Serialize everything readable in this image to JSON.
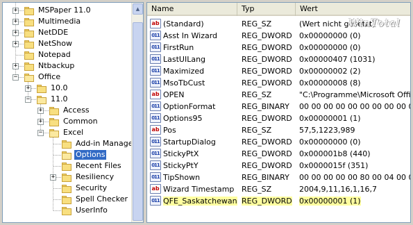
{
  "tree": {
    "items": [
      {
        "label": "MSPaper 11.0",
        "level": 1,
        "expander": "+",
        "selected": false
      },
      {
        "label": "Multimedia",
        "level": 1,
        "expander": "+",
        "selected": false
      },
      {
        "label": "NetDDE",
        "level": 1,
        "expander": "+",
        "selected": false
      },
      {
        "label": "NetShow",
        "level": 1,
        "expander": "+",
        "selected": false
      },
      {
        "label": "Notepad",
        "level": 1,
        "expander": "",
        "selected": false
      },
      {
        "label": "Ntbackup",
        "level": 1,
        "expander": "+",
        "selected": false
      },
      {
        "label": "Office",
        "level": 1,
        "expander": "-",
        "selected": false
      },
      {
        "label": "10.0",
        "level": 2,
        "expander": "+",
        "selected": false
      },
      {
        "label": "11.0",
        "level": 2,
        "expander": "-",
        "selected": false
      },
      {
        "label": "Access",
        "level": 3,
        "expander": "+",
        "selected": false
      },
      {
        "label": "Common",
        "level": 3,
        "expander": "+",
        "selected": false
      },
      {
        "label": "Excel",
        "level": 3,
        "expander": "-",
        "selected": false
      },
      {
        "label": "Add-in Manage",
        "level": 4,
        "expander": "",
        "selected": false
      },
      {
        "label": "Options",
        "level": 4,
        "expander": "",
        "selected": true
      },
      {
        "label": "Recent Files",
        "level": 4,
        "expander": "",
        "selected": false
      },
      {
        "label": "Resiliency",
        "level": 4,
        "expander": "+",
        "selected": false
      },
      {
        "label": "Security",
        "level": 4,
        "expander": "",
        "selected": false
      },
      {
        "label": "Spell Checker",
        "level": 4,
        "expander": "",
        "selected": false
      },
      {
        "label": "UserInfo",
        "level": 4,
        "expander": "",
        "selected": false
      }
    ]
  },
  "list": {
    "columns": {
      "name": "Name",
      "type": "Typ",
      "value": "Wert"
    },
    "rows": [
      {
        "icon": "ab",
        "name": "(Standard)",
        "type": "REG_SZ",
        "value": "(Wert nicht gesetzt)",
        "highlight": false
      },
      {
        "icon": "bin",
        "name": "Asst In Wizard",
        "type": "REG_DWORD",
        "value": "0x00000000 (0)",
        "highlight": false
      },
      {
        "icon": "bin",
        "name": "FirstRun",
        "type": "REG_DWORD",
        "value": "0x00000000 (0)",
        "highlight": false
      },
      {
        "icon": "bin",
        "name": "LastUILang",
        "type": "REG_DWORD",
        "value": "0x00000407 (1031)",
        "highlight": false
      },
      {
        "icon": "bin",
        "name": "Maximized",
        "type": "REG_DWORD",
        "value": "0x00000002 (2)",
        "highlight": false
      },
      {
        "icon": "bin",
        "name": "MsoTbCust",
        "type": "REG_DWORD",
        "value": "0x00000008 (8)",
        "highlight": false
      },
      {
        "icon": "ab",
        "name": "OPEN",
        "type": "REG_SZ",
        "value": "\"C:\\Programme\\Microsoft Office\\",
        "highlight": false
      },
      {
        "icon": "bin",
        "name": "OptionFormat",
        "type": "REG_BINARY",
        "value": "00 00 00 00 00 00 00 00 00 00 00 0",
        "highlight": false
      },
      {
        "icon": "bin",
        "name": "Options95",
        "type": "REG_DWORD",
        "value": "0x00000001 (1)",
        "highlight": false
      },
      {
        "icon": "ab",
        "name": "Pos",
        "type": "REG_SZ",
        "value": "57,5,1223,989",
        "highlight": false
      },
      {
        "icon": "bin",
        "name": "StartupDialog",
        "type": "REG_DWORD",
        "value": "0x00000000 (0)",
        "highlight": false
      },
      {
        "icon": "bin",
        "name": "StickyPtX",
        "type": "REG_DWORD",
        "value": "0x000001b8 (440)",
        "highlight": false
      },
      {
        "icon": "bin",
        "name": "StickyPtY",
        "type": "REG_DWORD",
        "value": "0x0000015f (351)",
        "highlight": false
      },
      {
        "icon": "bin",
        "name": "TipShown",
        "type": "REG_BINARY",
        "value": "00 00 00 00 00 80 00 04 00 00 00 0",
        "highlight": false
      },
      {
        "icon": "ab",
        "name": "Wizard Timestamp",
        "type": "REG_SZ",
        "value": "2004,9,11,16,1,16,7",
        "highlight": false
      },
      {
        "icon": "bin",
        "name": "QFE_Saskatchewan",
        "type": "REG_DWORD",
        "value": "0x00000001 (1)",
        "highlight": true
      }
    ]
  },
  "watermark": "WinTotal",
  "colors": {
    "selection": "#316ac5",
    "highlight_row": "#ffffa0"
  },
  "icons": {
    "string_value": "ab-string-icon",
    "binary_value": "binary-value-icon",
    "folder": "folder-icon"
  }
}
